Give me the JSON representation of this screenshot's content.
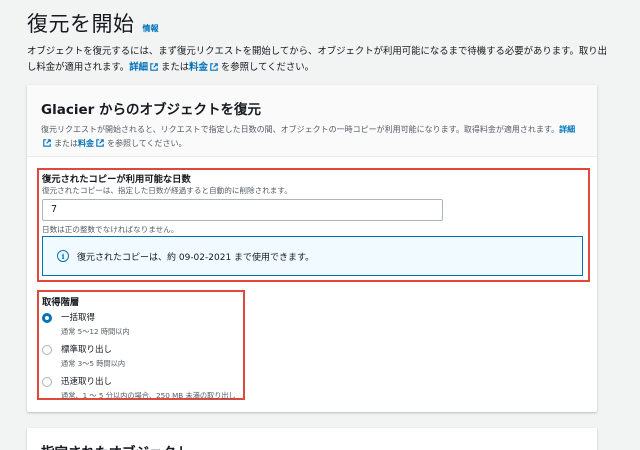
{
  "header": {
    "title": "復元を開始",
    "info_link": "情報"
  },
  "intro": {
    "text": "オブジェクトを復元するには、まず復元リクエストを開始してから、オブジェクトが利用可能になるまで待機する必要があります。取り出し料金が適用されます。",
    "details_link": "詳細",
    "or": "または",
    "pricing_link": "料金",
    "suffix": "を参照してください。"
  },
  "glacier_card": {
    "title": "Glacier からのオブジェクトを復元",
    "desc": "復元リクエストが開始されると、リクエストで指定した日数の間、オブジェクトの一時コピーが利用可能になります。取得料金が適用されます。",
    "details_link": "詳細",
    "or": "または",
    "pricing_link": "料金",
    "suffix": "を参照してください。"
  },
  "days": {
    "label": "復元されたコピーが利用可能な日数",
    "desc": "復元されたコピーは、指定した日数が経過すると自動的に削除されます。",
    "value": "7",
    "hint": "日数は正の整数でなければなりません。",
    "alert": "復元されたコピーは、約 09-02-2021 まで使用できます。"
  },
  "tier": {
    "label": "取得階層",
    "options": [
      {
        "title": "一括取得",
        "desc": "通常 5～12 時間以内",
        "checked": true
      },
      {
        "title": "標準取り出し",
        "desc": "通常 3～5 時間以内",
        "checked": false
      },
      {
        "title": "迅速取り出し",
        "desc": "通常、1 ～ 5 分以内の場合、250 MB 未満の取り出し",
        "checked": false
      }
    ]
  },
  "objects_card": {
    "title": "指定されたオブジェクト"
  },
  "colors": {
    "link": "#0073bb",
    "highlight_border": "#e0483b",
    "info_bg": "#f1faff"
  },
  "icons": {
    "external": "external-link-icon",
    "info": "info-circle-icon"
  }
}
